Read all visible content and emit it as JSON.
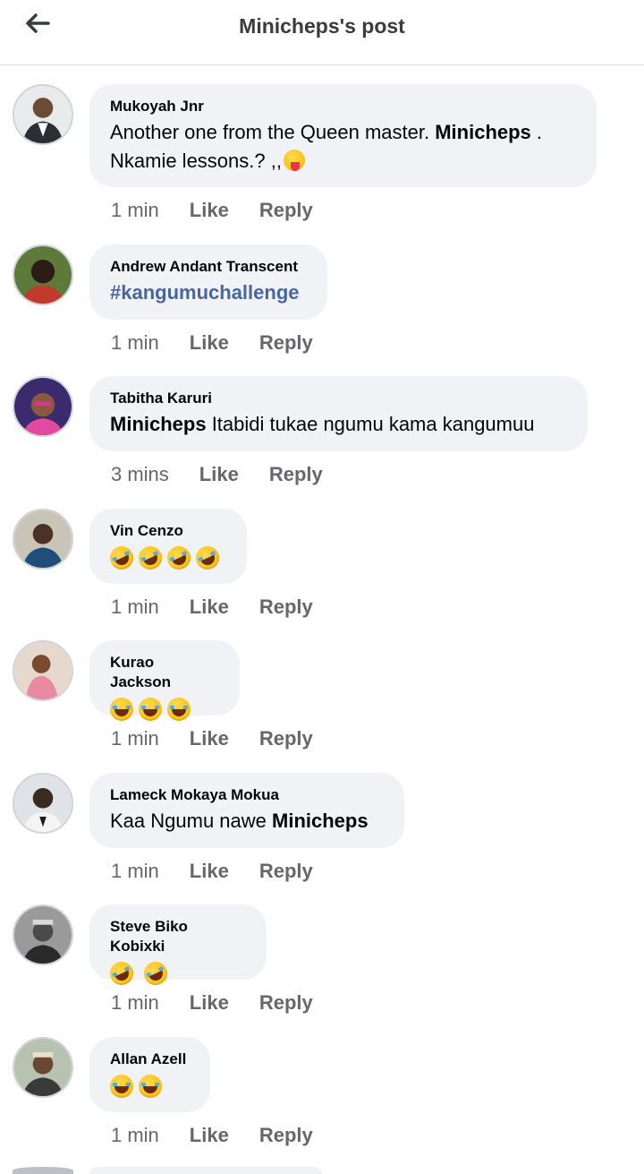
{
  "header": {
    "title": "Minicheps's post"
  },
  "comments": [
    {
      "author": "Mukoyah Jnr",
      "line1_prefix": "Another one from the Queen master. ",
      "line1_mention": "Minicheps",
      "line1_suffix": " .",
      "line2": "Nkamie lessons.? ,,",
      "time": "1 min",
      "like": "Like",
      "reply": "Reply"
    },
    {
      "author": "Andrew Andant Transcent",
      "hashtag": "#kangumuchallenge",
      "time": "1 min",
      "like": "Like",
      "reply": "Reply"
    },
    {
      "author": "Tabitha Karuri",
      "mention": "Minicheps",
      "text": " Itabidi tukae ngumu kama kangumuu",
      "time": "3 mins",
      "like": "Like",
      "reply": "Reply"
    },
    {
      "author": "Vin Cenzo",
      "emoji_count": 4,
      "time": "1 min",
      "like": "Like",
      "reply": "Reply"
    },
    {
      "author": "Kurao Jackson",
      "emoji_count": 3,
      "time": "1 min",
      "like": "Like",
      "reply": "Reply"
    },
    {
      "author": "Lameck Mokaya Mokua",
      "text": "Kaa Ngumu nawe ",
      "mention": "Minicheps",
      "time": "1 min",
      "like": "Like",
      "reply": "Reply"
    },
    {
      "author": "Steve Biko Kobixki",
      "emoji_count": 2,
      "time": "1 min",
      "like": "Like",
      "reply": "Reply"
    },
    {
      "author": "Allan Azell",
      "emoji_count": 2,
      "time": "1 min",
      "like": "Like",
      "reply": "Reply"
    }
  ],
  "icons": {
    "back": "arrow-left-icon",
    "laugh": "rolling-laughing-emoji",
    "tongue": "winking-tongue-emoji"
  },
  "colors": {
    "bubble": "#f0f2f5",
    "hashtag": "#4a66a0",
    "meta": "#65676b"
  }
}
